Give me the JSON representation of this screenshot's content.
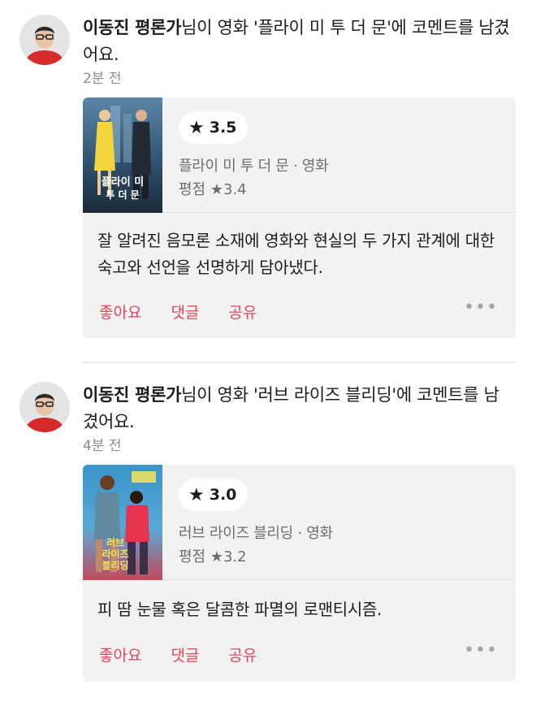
{
  "colors": {
    "accent": "#e0455e",
    "card_bg": "#f2f2f2",
    "muted": "#8e8e8e"
  },
  "feed": [
    {
      "author": "이동진 평론가",
      "headline_rest": "님이 영화 '플라이 미 투 더 문'에 코멘트를 남겼어요.",
      "time": "2분 전",
      "my_rating": "3.5",
      "movie_meta": "플라이 미 투 더 문 · 영화",
      "avg_label": "평점",
      "avg_value": "3.4",
      "comment": "잘 알려진 음모론 소재에 영화와 현실의 두 가지 관계에 대한 숙고와 선언을 선명하게 담아냈다.",
      "actions": {
        "like": "좋아요",
        "comment": "댓글",
        "share": "공유"
      },
      "more_icon": "ellipsis-icon"
    },
    {
      "author": "이동진 평론가",
      "headline_rest": "님이 영화 '러브 라이즈 블리딩'에 코멘트를 남겼어요.",
      "time": "4분 전",
      "my_rating": "3.0",
      "movie_meta": "러브 라이즈 블리딩 · 영화",
      "avg_label": "평점",
      "avg_value": "3.2",
      "comment": "피 땀 눈물 혹은 달콤한 파멸의 로맨티시즘.",
      "actions": {
        "like": "좋아요",
        "comment": "댓글",
        "share": "공유"
      },
      "more_icon": "ellipsis-icon"
    }
  ]
}
